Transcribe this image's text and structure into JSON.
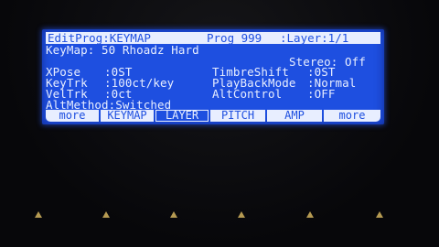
{
  "header": {
    "mode": "EditProg:KEYMAP",
    "prog": "Prog 999",
    "layer": ":Layer:1/1"
  },
  "keymap": {
    "label": "KeyMap:",
    "value": "50 Rhoadz Hard"
  },
  "stereo": "Stereo: Off",
  "params_left": [
    {
      "label": "XPose",
      "value": ":0ST"
    },
    {
      "label": "KeyTrk",
      "value": ":100ct/key"
    },
    {
      "label": "VelTrk",
      "value": ":0ct"
    },
    {
      "label": "AltMethod",
      "value": ":Switched"
    }
  ],
  "params_right": [
    {
      "label": "TimbreShift",
      "value": ":0ST"
    },
    {
      "label": "PlayBackMode",
      "value": ":Normal"
    },
    {
      "label": "AltControl",
      "value": ":OFF"
    }
  ],
  "tabs": [
    {
      "label": "more"
    },
    {
      "label": "KEYMAP"
    },
    {
      "label": "LAYER"
    },
    {
      "label": "PITCH"
    },
    {
      "label": "AMP"
    },
    {
      "label": "more"
    }
  ],
  "colors": {
    "lcd_bg": "#1e4fe0",
    "lcd_text": "#e8eeff",
    "arrow": "#b59a52"
  }
}
